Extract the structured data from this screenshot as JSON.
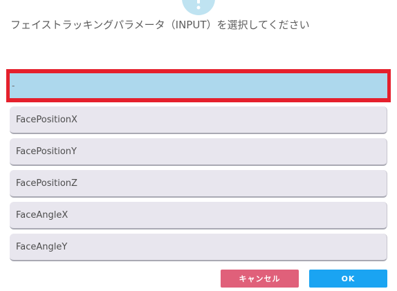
{
  "dialog": {
    "icon": "info-icon",
    "prompt": "フェイストラッキングパラメータ（INPUT）を選択してください"
  },
  "list": {
    "selected": "-",
    "items": [
      "FacePositionX",
      "FacePositionY",
      "FacePositionZ",
      "FaceAngleX",
      "FaceAngleY"
    ]
  },
  "buttons": {
    "cancel": "キャンセル",
    "ok": "OK"
  },
  "colors": {
    "selection_border": "#e5202c",
    "selection_fill": "#add8ed",
    "item_fill": "#e8e6ee",
    "cancel": "#e0607a",
    "ok": "#1aa4f2",
    "icon": "#bfe3f1"
  }
}
